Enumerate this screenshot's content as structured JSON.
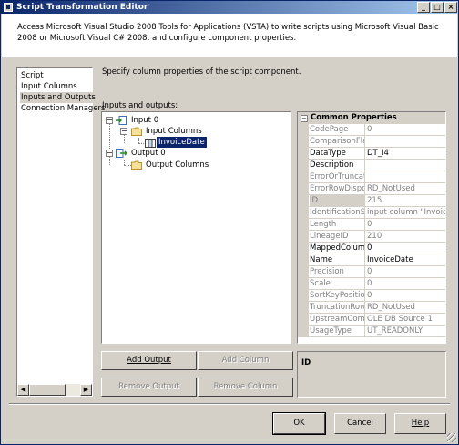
{
  "window": {
    "title": "Script Transformation Editor",
    "controls": {
      "minimize": "_",
      "maximize": "□",
      "close": "×"
    }
  },
  "description": "Access Microsoft Visual Studio 2008 Tools for Applications (VSTA) to write scripts using Microsoft Visual Basic 2008 or Microsoft Visual C# 2008, and configure component properties.",
  "nav": {
    "items": [
      {
        "label": "Script"
      },
      {
        "label": "Input Columns"
      },
      {
        "label": "Inputs and Outputs"
      },
      {
        "label": "Connection Managers"
      }
    ],
    "selected": "Inputs and Outputs"
  },
  "main": {
    "instruction": "Specify column properties of the script component.",
    "io_label_prefix": "I",
    "io_label_rest": "nputs and outputs:",
    "tree": {
      "input": "Input 0",
      "input_columns": "Input Columns",
      "column": "InvoiceDate",
      "output": "Output 0",
      "output_columns": "Output Columns"
    },
    "buttons": {
      "add_output": "Add Output",
      "add_column": "Add Column",
      "remove_output": "Remove Output",
      "remove_column": "Remove Column"
    }
  },
  "properties": {
    "category": "Common Properties",
    "rows": [
      {
        "name": "CodePage",
        "value": "0"
      },
      {
        "name": "ComparisonFlags",
        "value": ""
      },
      {
        "name": "DataType",
        "value": "DT_I4"
      },
      {
        "name": "Description",
        "value": ""
      },
      {
        "name": "ErrorOrTruncationOperation",
        "value": ""
      },
      {
        "name": "ErrorRowDisposition",
        "value": "RD_NotUsed"
      },
      {
        "name": "ID",
        "value": "215"
      },
      {
        "name": "IdentificationString",
        "value": "input column \"InvoiceDate\""
      },
      {
        "name": "Length",
        "value": "0"
      },
      {
        "name": "LineageID",
        "value": "210"
      },
      {
        "name": "MappedColumnID",
        "value": "0"
      },
      {
        "name": "Name",
        "value": "InvoiceDate"
      },
      {
        "name": "Precision",
        "value": "0"
      },
      {
        "name": "Scale",
        "value": "0"
      },
      {
        "name": "SortKeyPosition",
        "value": "0"
      },
      {
        "name": "TruncationRowDisposition",
        "value": "RD_NotUsed"
      },
      {
        "name": "UpstreamComponentName",
        "value": "OLE DB Source 1"
      },
      {
        "name": "UsageType",
        "value": "UT_READONLY"
      }
    ],
    "help_title": "ID"
  },
  "dialog_buttons": {
    "ok": "OK",
    "cancel": "Cancel",
    "help": "Help"
  }
}
